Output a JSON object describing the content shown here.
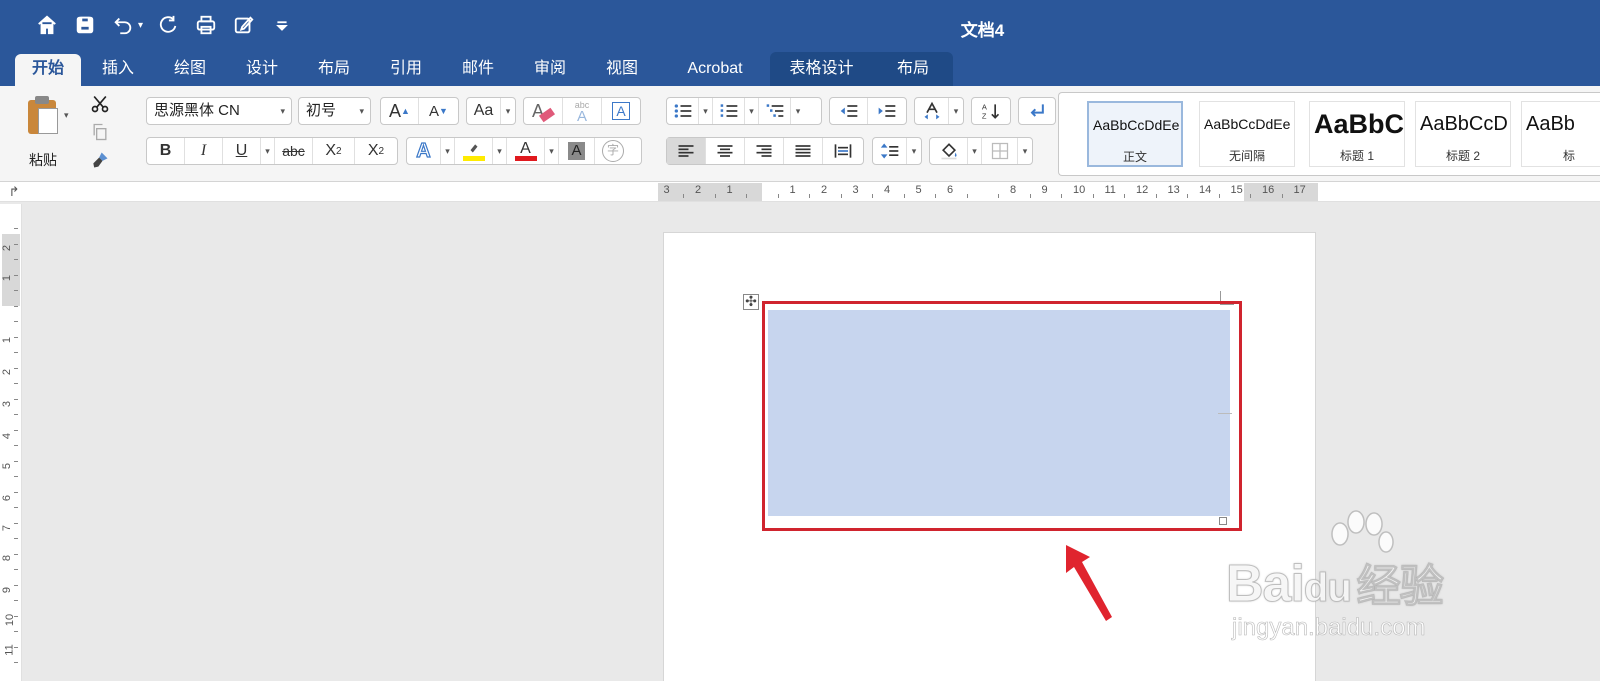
{
  "window": {
    "title": "文档4"
  },
  "tabs": [
    {
      "label": "开始",
      "active": true
    },
    {
      "label": "插入"
    },
    {
      "label": "绘图"
    },
    {
      "label": "设计"
    },
    {
      "label": "布局"
    },
    {
      "label": "引用"
    },
    {
      "label": "邮件"
    },
    {
      "label": "审阅"
    },
    {
      "label": "视图"
    },
    {
      "label": "Acrobat"
    },
    {
      "label": "表格设计",
      "contextual": true
    },
    {
      "label": "布局",
      "contextual": true
    }
  ],
  "clipboard": {
    "paste_label": "粘贴"
  },
  "font": {
    "name": "思源黑体 CN",
    "size": "初号",
    "bold": "B",
    "italic": "I",
    "underline": "U",
    "strikethrough": "abc",
    "subscript": "X",
    "subscript_mark": "2",
    "superscript": "X",
    "superscript_mark": "2",
    "grow": "A",
    "shrink": "A",
    "change_case": "Aa",
    "color_letter": "A",
    "shade_letter": "A",
    "effects_letter": "A",
    "enclose_char": "字",
    "clear_format_letter": "A",
    "phonetic": "abc",
    "phonetic_letter": "A",
    "border_letter": "A"
  },
  "styles": [
    {
      "sample": "AaBbCcDdEe",
      "name": "正文",
      "selected": true
    },
    {
      "sample": "AaBbCcDdEe",
      "name": "无间隔"
    },
    {
      "sample": "AaBbC",
      "name": "标题 1"
    },
    {
      "sample": "AaBbCcD",
      "name": "标题 2"
    },
    {
      "sample": "AaBb",
      "name": "标"
    }
  ],
  "ruler": {
    "horizontal": [
      "3",
      "2",
      "1",
      "1",
      "2",
      "3",
      "4",
      "5",
      "6",
      "8",
      "9",
      "10",
      "11",
      "12",
      "13",
      "14",
      "15",
      "16",
      "17"
    ],
    "vertical": [
      "2",
      "1",
      "1",
      "2",
      "3",
      "4",
      "5",
      "6",
      "7",
      "8",
      "9",
      "10",
      "11"
    ]
  },
  "watermark": {
    "brand_a": "Bai",
    "brand_b": "du",
    "brand_cn": "经验",
    "url": "jingyan.baidu.com"
  },
  "colors": {
    "ribbon_blue": "#2b579a",
    "highlight_red": "#d0242e",
    "cell_fill": "#c7d5ee"
  }
}
